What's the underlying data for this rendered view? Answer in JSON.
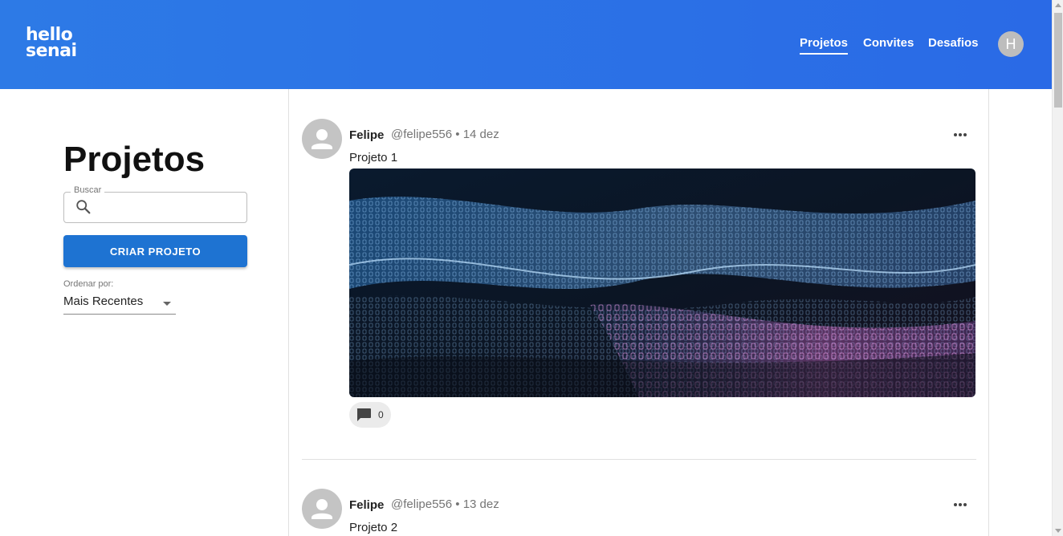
{
  "header": {
    "logo_line1": "hello",
    "logo_line2": "senai",
    "nav": [
      {
        "label": "Projetos",
        "active": true
      },
      {
        "label": "Convites",
        "active": false
      },
      {
        "label": "Desafios",
        "active": false
      }
    ],
    "user_initial": "H"
  },
  "sidebar": {
    "title": "Projetos",
    "search": {
      "label": "Buscar",
      "value": "",
      "placeholder": ""
    },
    "create_button": "CRIAR PROJETO",
    "sort": {
      "label": "Ordenar por:",
      "value": "Mais Recentes"
    }
  },
  "feed": {
    "posts": [
      {
        "author": "Felipe",
        "handle": "@felipe556 • 14 dez",
        "title": "Projeto 1",
        "comments": "0",
        "has_image": true
      },
      {
        "author": "Felipe",
        "handle": "@felipe556 • 13 dez",
        "title": "Projeto 2",
        "comments": "",
        "has_image": false
      }
    ]
  },
  "colors": {
    "appbar": "#2a6ae6",
    "primary_button": "#1e73d2"
  }
}
